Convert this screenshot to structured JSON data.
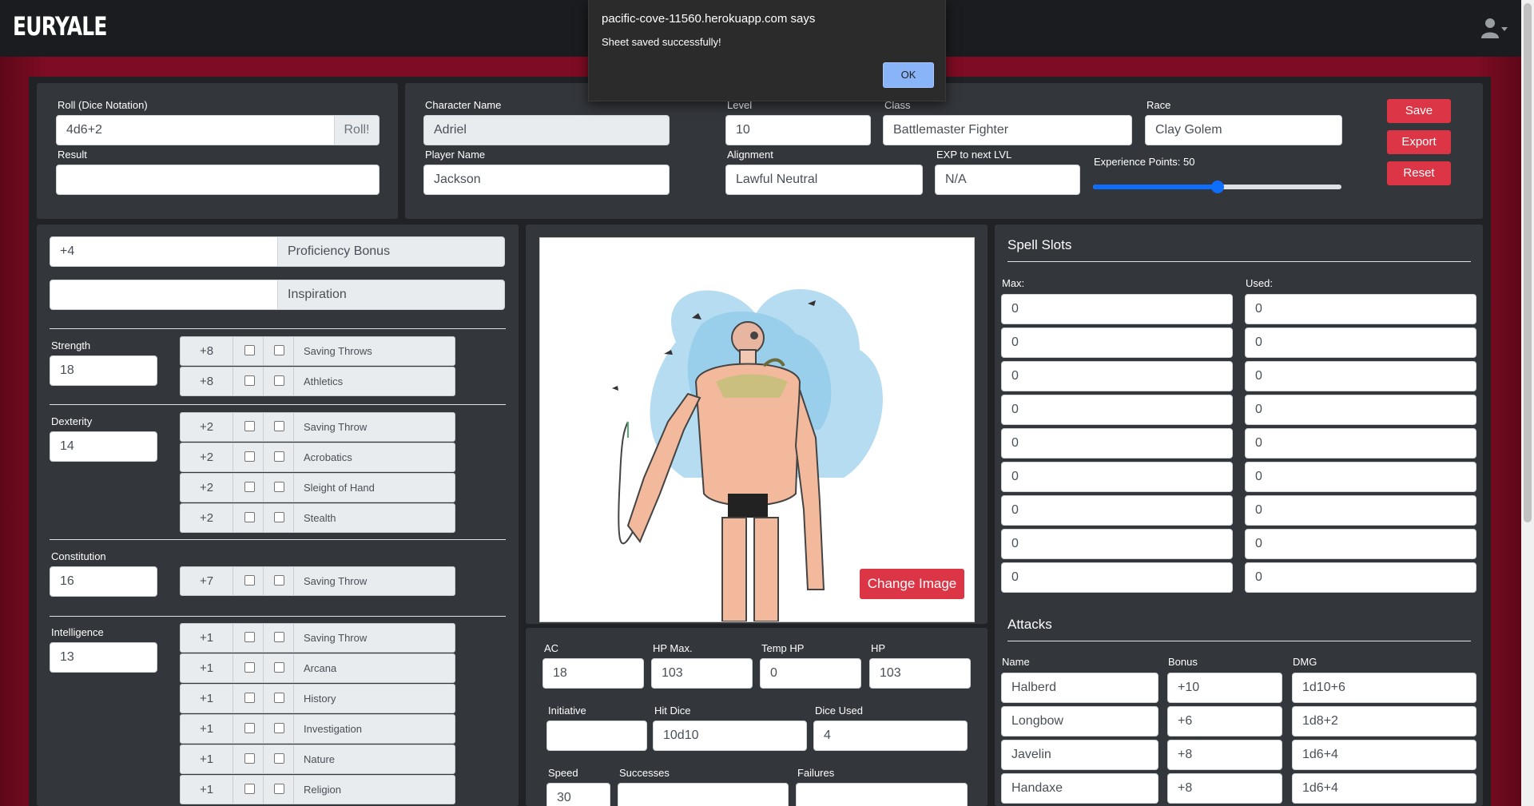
{
  "app": {
    "brand": "EURYALE"
  },
  "dialog": {
    "title": "pacific-cove-11560.herokuapp.com says",
    "message": "Sheet saved successfully!",
    "ok_label": "OK"
  },
  "roll": {
    "label": "Roll (Dice Notation)",
    "value": "4d6+2",
    "button": "Roll!",
    "result_label": "Result",
    "result_value": ""
  },
  "character": {
    "name_label": "Character Name",
    "name": "Adriel",
    "player_label": "Player Name",
    "player": "Jackson",
    "level_label": "Level",
    "level": "10",
    "class_label": "Class",
    "class": "Battlemaster Fighter",
    "race_label": "Race",
    "race": "Clay Golem",
    "alignment_label": "Alignment",
    "alignment": "Lawful Neutral",
    "exp_next_label": "EXP to next LVL",
    "exp_next": "N/A",
    "xp_label": "Experience Points: 50",
    "xp_slider_fraction": 0.5
  },
  "actions": {
    "save": "Save",
    "export": "Export",
    "reset": "Reset"
  },
  "proficiency": {
    "value": "+4",
    "label": "Proficiency Bonus"
  },
  "inspiration": {
    "value": "",
    "label": "Inspiration"
  },
  "abilities": [
    {
      "name": "Strength",
      "score": "18",
      "skills": [
        {
          "mod": "+8",
          "name": "Saving Throws"
        },
        {
          "mod": "+8",
          "name": "Athletics"
        }
      ]
    },
    {
      "name": "Dexterity",
      "score": "14",
      "skills": [
        {
          "mod": "+2",
          "name": "Saving Throw"
        },
        {
          "mod": "+2",
          "name": "Acrobatics"
        },
        {
          "mod": "+2",
          "name": "Sleight of Hand"
        },
        {
          "mod": "+2",
          "name": "Stealth"
        }
      ]
    },
    {
      "name": "Constitution",
      "score": "16",
      "skills": [
        {
          "mod": "+7",
          "name": "Saving Throw"
        }
      ]
    },
    {
      "name": "Intelligence",
      "score": "13",
      "skills": [
        {
          "mod": "+1",
          "name": "Saving Throw"
        },
        {
          "mod": "+1",
          "name": "Arcana"
        },
        {
          "mod": "+1",
          "name": "History"
        },
        {
          "mod": "+1",
          "name": "Investigation"
        },
        {
          "mod": "+1",
          "name": "Nature"
        },
        {
          "mod": "+1",
          "name": "Religion"
        }
      ]
    }
  ],
  "portrait": {
    "change_label": "Change Image"
  },
  "combat": {
    "ac_label": "AC",
    "ac": "18",
    "hpmax_label": "HP Max.",
    "hpmax": "103",
    "temphp_label": "Temp HP",
    "temphp": "0",
    "hp_label": "HP",
    "hp": "103",
    "initiative_label": "Initiative",
    "initiative": "",
    "hitdice_label": "Hit Dice",
    "hitdice": "10d10",
    "diceused_label": "Dice Used",
    "diceused": "4",
    "speed_label": "Speed",
    "speed": "30",
    "successes_label": "Successes",
    "successes": "",
    "failures_label": "Failures",
    "failures": ""
  },
  "spells": {
    "title": "Spell Slots",
    "max_label": "Max:",
    "used_label": "Used:",
    "max": [
      "0",
      "0",
      "0",
      "0",
      "0",
      "0",
      "0",
      "0",
      "0"
    ],
    "used": [
      "0",
      "0",
      "0",
      "0",
      "0",
      "0",
      "0",
      "0",
      "0"
    ]
  },
  "attacks": {
    "title": "Attacks",
    "name_label": "Name",
    "bonus_label": "Bonus",
    "dmg_label": "DMG",
    "rows": [
      {
        "name": "Halberd",
        "bonus": "+10",
        "dmg": "1d10+6"
      },
      {
        "name": "Longbow",
        "bonus": "+6",
        "dmg": "1d8+2"
      },
      {
        "name": "Javelin",
        "bonus": "+8",
        "dmg": "1d6+4"
      },
      {
        "name": "Handaxe",
        "bonus": "+8",
        "dmg": "1d6+4"
      }
    ]
  },
  "colors": {
    "accent_red": "#dc3545",
    "brand_bg": "#1b1c1f",
    "panel": "#33363b",
    "slider_blue": "#0d6efd"
  }
}
